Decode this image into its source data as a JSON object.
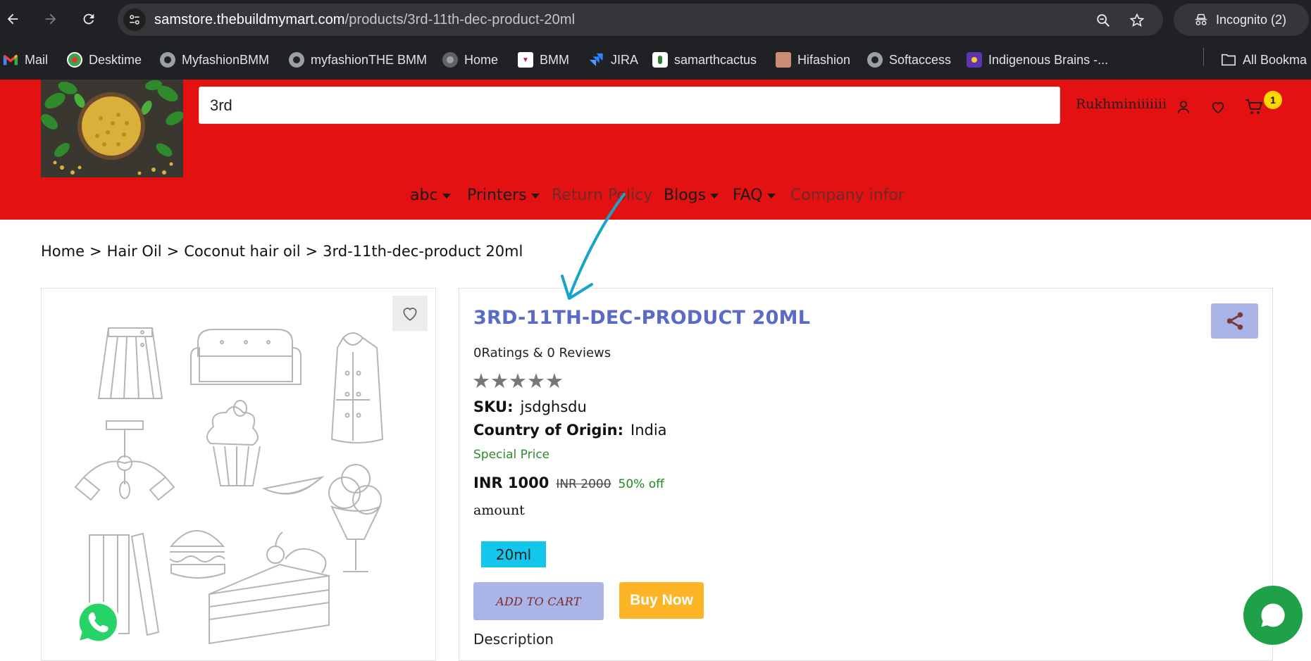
{
  "browser": {
    "url_host": "samstore.thebuildmymart.com",
    "url_path": "/products/3rd-11th-dec-product-20ml",
    "incognito_label": "Incognito (2)",
    "bookmarks": [
      {
        "label": "Mail",
        "icon": "gmail-icon"
      },
      {
        "label": "Desktime",
        "icon": "desktime-icon"
      },
      {
        "label": "MyfashionBMM",
        "icon": "globe-icon"
      },
      {
        "label": "myfashionTHE BMM",
        "icon": "globe-icon"
      },
      {
        "label": "Home",
        "icon": "globe-icon"
      },
      {
        "label": "BMM",
        "icon": "bmm-icon"
      },
      {
        "label": "JIRA",
        "icon": "jira-icon"
      },
      {
        "label": "samarthcactus",
        "icon": "cactus-icon"
      },
      {
        "label": "Hifashion",
        "icon": "hifashion-icon"
      },
      {
        "label": "Softaccess",
        "icon": "globe-icon"
      },
      {
        "label": "Indigenous Brains -...",
        "icon": "indigenous-icon"
      }
    ],
    "all_bookmarks_label": "All Bookma"
  },
  "header": {
    "search_value": "3rd",
    "username": "Rukhminiiiiiii",
    "cart_count": "1",
    "menu": [
      {
        "label": "abc",
        "dropdown": true
      },
      {
        "label": "Printers",
        "dropdown": true
      },
      {
        "label": "Return Policy",
        "dropdown": false
      },
      {
        "label": "Blogs",
        "dropdown": true
      },
      {
        "label": "FAQ",
        "dropdown": true
      },
      {
        "label": "Company infor",
        "dropdown": false
      }
    ]
  },
  "breadcrumb": {
    "items": [
      "Home",
      "Hair Oil",
      "Coconut hair oil",
      "3rd-11th-dec-product 20ml"
    ],
    "separator": ">"
  },
  "product": {
    "title": "3RD-11TH-DEC-PRODUCT 20ML",
    "ratings_text": "0Ratings & 0 Reviews",
    "stars": "★★★★★",
    "rating_value": 0,
    "sku_label": "SKU:",
    "sku_value": "jsdghsdu",
    "origin_label": "Country of Origin:",
    "origin_value": "India",
    "special_price_label": "Special Price",
    "price": "INR 1000",
    "mrp": "INR 2000",
    "discount": "50% off",
    "amount_label": "amount",
    "variant": "20ml",
    "add_to_cart_label": "ADD TO CART",
    "buy_now_label": "Buy Now",
    "description_label": "Description"
  },
  "colors": {
    "header_red": "#e31111",
    "title_blue": "#5a6bc5",
    "button_lavender": "#aab4e6",
    "buy_now_orange": "#fbb527",
    "variant_cyan": "#12c6ec",
    "discount_green": "#1d8a1d",
    "chat_green": "#1fa149",
    "annotation_teal": "#1aa3c8"
  }
}
